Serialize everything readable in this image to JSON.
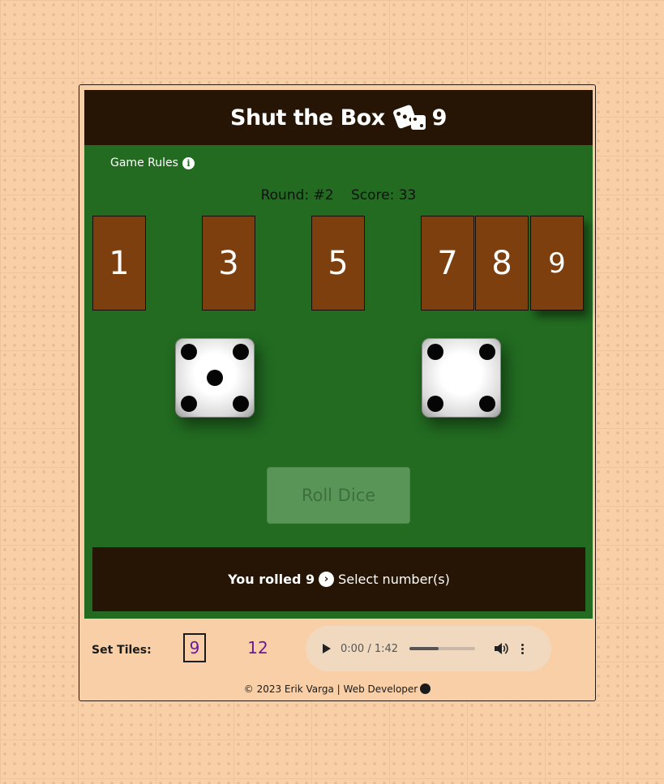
{
  "header": {
    "title": "Shut the Box",
    "title_suffix": "9",
    "icon": "dice-icon"
  },
  "rules": {
    "label": "Game Rules",
    "icon": "info-icon"
  },
  "status": {
    "round": "Round: #2",
    "score": "Score: 33"
  },
  "tiles": [
    {
      "label": "1",
      "state": "open"
    },
    {
      "label": "3",
      "state": "open"
    },
    {
      "label": "5",
      "state": "open"
    },
    {
      "label": "7",
      "state": "open"
    },
    {
      "label": "8",
      "state": "open"
    },
    {
      "label": "9",
      "state": "selected"
    }
  ],
  "dice": [
    {
      "value": 5
    },
    {
      "value": 4
    }
  ],
  "roll_button": {
    "label": "Roll Dice",
    "disabled": true
  },
  "message": {
    "bold": "You rolled 9",
    "text": "Select number(s)",
    "icon": "arrow-right-icon"
  },
  "settings": {
    "label": "Set Tiles:",
    "options": [
      {
        "label": "9",
        "active": true
      },
      {
        "label": "12",
        "active": false
      }
    ]
  },
  "audio": {
    "time": "0:00 / 1:42",
    "progress": 0.45
  },
  "footer": {
    "text": "© 2023 Erik Varga | Web Developer",
    "icon": "github-icon"
  },
  "colors": {
    "board": "#226b21",
    "header": "#261504",
    "tile": "#7c3f0d",
    "background": "#f8cfa6",
    "accent": "#6a1b9a"
  }
}
